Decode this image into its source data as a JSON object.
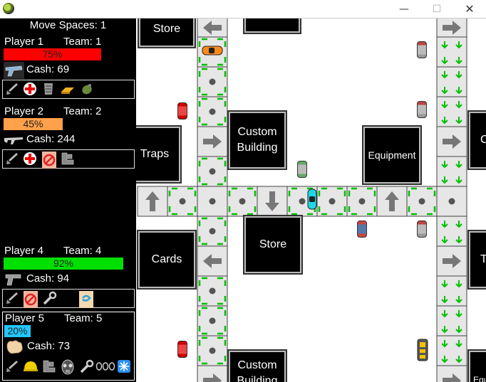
{
  "window": {
    "min_glyph": "—",
    "max_glyph": "☐",
    "close_glyph": "✕"
  },
  "panel": {
    "move_spaces": "Move Spaces: 1",
    "players": [
      {
        "name": "Player 1",
        "team": "Team: 1",
        "health_label": "75%",
        "health": 75,
        "color": "#ff0000",
        "cash": "Cash: 69",
        "weapon": "laser-pistol-icon",
        "items": [
          "shovel-icon",
          "medkit-icon",
          "armor-icon",
          "gold-bar-icon",
          "grenade-icon"
        ]
      },
      {
        "name": "Player 2",
        "team": "Team: 2",
        "health_label": "45%",
        "health": 45,
        "color": "#ffa04a",
        "cash": "Cash: 244",
        "weapon": "assault-rifle-icon",
        "items": [
          "shovel-icon",
          "medkit-icon",
          "no-entry-card-icon",
          "boots-icon"
        ]
      },
      {
        "name": "Player 4",
        "team": "Team: 4",
        "health_label": "92%",
        "health": 92,
        "color": "#00e000",
        "cash": "Cash: 94",
        "weapon": "pistol-icon",
        "items": [
          "shovel-icon",
          "no-entry-card-icon",
          "wrench-icon",
          "teleport-card-icon"
        ]
      },
      {
        "name": "Player 5",
        "team": "Team: 5",
        "health_label": "20%",
        "health": 20,
        "color": "#22c8ff",
        "cash": "Cash: 73",
        "weapon": "fist-icon",
        "items": [
          "shovel-icon",
          "helmet-icon",
          "boots-icon",
          "gas-mask-icon",
          "wrench-icon",
          "chain-icon",
          "snowflake-icon"
        ]
      }
    ]
  },
  "board": {
    "buildings": [
      "Store",
      "",
      "Custom Building",
      "Traps",
      "Equipment",
      "C",
      "Store",
      "Cards",
      "T",
      "Custom Building",
      "Equ"
    ]
  }
}
